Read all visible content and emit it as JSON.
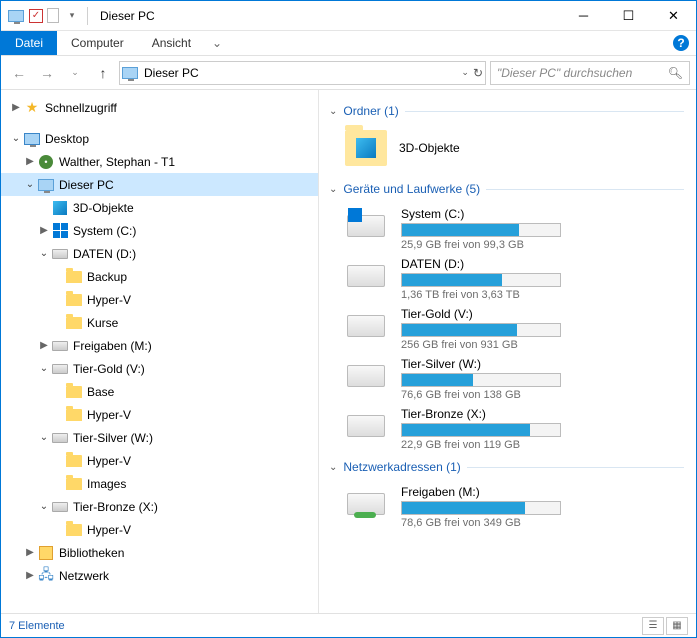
{
  "title": "Dieser PC",
  "ribbon": {
    "file": "Datei",
    "computer": "Computer",
    "view": "Ansicht"
  },
  "breadcrumb": "Dieser PC",
  "search_placeholder": "\"Dieser PC\" durchsuchen",
  "tree": {
    "quick": "Schnellzugriff",
    "desktop": "Desktop",
    "user": "Walther, Stephan - T1",
    "thispc": "Dieser PC",
    "obj3d": "3D-Objekte",
    "sysc": "System (C:)",
    "daten": "DATEN (D:)",
    "backup": "Backup",
    "hyperv": "Hyper-V",
    "kurse": "Kurse",
    "freigaben": "Freigaben (M:)",
    "gold": "Tier-Gold (V:)",
    "base": "Base",
    "silver": "Tier-Silver (W:)",
    "images": "Images",
    "bronze": "Tier-Bronze (X:)",
    "libs": "Bibliotheken",
    "network": "Netzwerk"
  },
  "groups": {
    "folders": "Ordner (1)",
    "drives": "Geräte und Laufwerke (5)",
    "network": "Netzwerkadressen (1)"
  },
  "folder_item": "3D-Objekte",
  "drives": [
    {
      "name": "System (C:)",
      "free": "25,9 GB frei von 99,3 GB",
      "pct": 74,
      "sys": true
    },
    {
      "name": "DATEN (D:)",
      "free": "1,36 TB frei von 3,63 TB",
      "pct": 63
    },
    {
      "name": "Tier-Gold (V:)",
      "free": "256 GB frei von 931 GB",
      "pct": 73
    },
    {
      "name": "Tier-Silver (W:)",
      "free": "76,6 GB frei von 138 GB",
      "pct": 45
    },
    {
      "name": "Tier-Bronze (X:)",
      "free": "22,9 GB frei von 119 GB",
      "pct": 81
    }
  ],
  "netloc": {
    "name": "Freigaben (M:)",
    "free": "78,6 GB frei von 349 GB",
    "pct": 78
  },
  "status": "7 Elemente"
}
